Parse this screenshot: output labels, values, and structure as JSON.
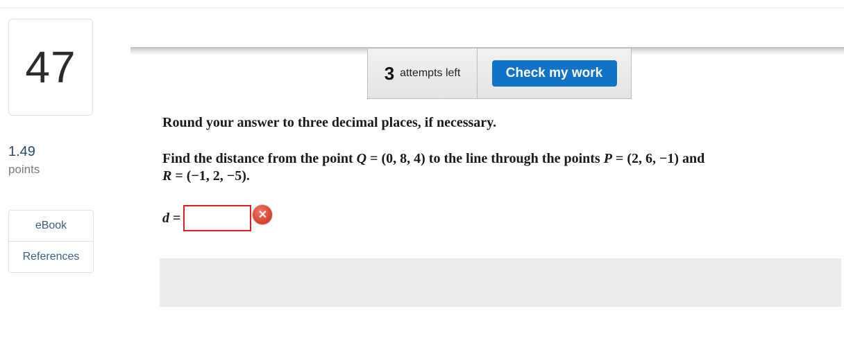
{
  "question": {
    "number": "47"
  },
  "points": {
    "value": "1.49",
    "label": "points"
  },
  "side_links": [
    {
      "label": "eBook"
    },
    {
      "label": "References"
    }
  ],
  "toolbar": {
    "attempts_count": "3",
    "attempts_text": "attempts left",
    "check_label": "Check my work",
    "check_color": "#1173c6"
  },
  "problem": {
    "instructions": "Round your answer to three decimal places, if necessary.",
    "line1_a": "Find the distance from the point ",
    "Q_var": "Q",
    "line1_b": " = (0, 8, 4) to the line through the points ",
    "P_var": "P",
    "line1_c": " = (2, 6, −1) and",
    "R_var": "R",
    "line2": " = (−1, 2, −5)."
  },
  "answer": {
    "var": "d",
    "eq": " =",
    "value": "",
    "status_icon": "x-icon",
    "status_color": "#d94432"
  }
}
